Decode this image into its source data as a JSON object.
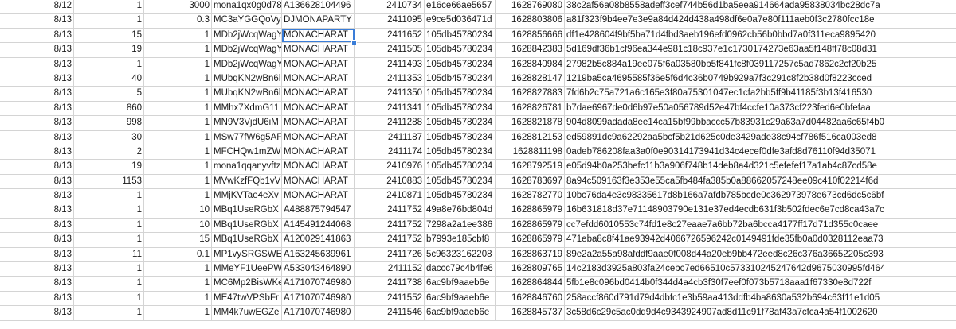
{
  "spreadsheet": {
    "selected_cell": {
      "row": 2,
      "col": 4
    },
    "rows": [
      [
        "8/12",
        "1",
        "3000",
        "mona1qx0g0d78",
        "A136628104496",
        "2410734",
        "e16ce66ae5657",
        "1628769080",
        "38c2af56a08b8558adeff3cef744b56d1ba5eea914664ada95838034bc28dc7a"
      ],
      [
        "8/13",
        "1",
        "0.3",
        "MC3aYGGQoVy",
        "DJMONAPARTY",
        "2411095",
        "e9ce5d036471d",
        "1628803806",
        "a81f323f9b4ee7e3e9a84d424d438a498df6e0a7e80f111aeb0f3c2780fcc18e"
      ],
      [
        "8/13",
        "15",
        "1",
        "MDb2jWcqWagY",
        "MONACHARAT",
        "2411652",
        "105db45780234",
        "1628856666",
        "df1e428604f9bf5ba71d4fbd3aeb196efd0962cb56b0bbd7a0f311eca9895420"
      ],
      [
        "8/13",
        "19",
        "1",
        "MDb2jWcqWagY",
        "MONACHARAT",
        "2411505",
        "105db45780234",
        "1628842383",
        "5d169df36b1cf96ea344e981c18c937e1c1730174273e63aa5f148ff78c08d31"
      ],
      [
        "8/13",
        "1",
        "1",
        "MDb2jWcqWagY",
        "MONACHARAT",
        "2411493",
        "105db45780234",
        "1628840984",
        "27982b5c884a19ee075f6a03580bb5f841fc8f039117257c5ad7862c2cf20b25"
      ],
      [
        "8/13",
        "40",
        "1",
        "MUbqKN2wBn6l",
        "MONACHARAT",
        "2411353",
        "105db45780234",
        "1628828147",
        "1219ba5ca4695585f36e5f6d4c36b0749b929a7f3c291c8f2b38d0f8223cced"
      ],
      [
        "8/13",
        "5",
        "1",
        "MUbqKN2wBn6l",
        "MONACHARAT",
        "2411350",
        "105db45780234",
        "1628827883",
        "7fd6b2c75a721a6c165e3f80a75301047ec1cfa2bb5ff9b41185f3b13f416530"
      ],
      [
        "8/13",
        "860",
        "1",
        "MMhx7XdmG11",
        "MONACHARAT",
        "2411341",
        "105db45780234",
        "1628826781",
        "b7dae6967de0d6b97e50a056789d52e47bf4ccfe10a373cf223fed6e0bfefaa"
      ],
      [
        "8/13",
        "998",
        "1",
        "MN9V3VjdU6iM",
        "MONACHARAT",
        "2411288",
        "105db45780234",
        "1628821878",
        "904d8099adada8ee14ca15bf99bbaccc57b83931c29a63a7d04482aa6c65f4b0"
      ],
      [
        "8/13",
        "30",
        "1",
        "MSw77fW6g5AF",
        "MONACHARAT",
        "2411187",
        "105db45780234",
        "1628812153",
        "ed59891dc9a62292aa5bcf5b21d625c0de3429ade38c94cf786f516ca003ed8"
      ],
      [
        "8/13",
        "2",
        "1",
        "MFCHQw1mZW",
        "MONACHARAT",
        "2411174",
        "105db45780234",
        "1628811198",
        "0adeb786208faa3a0f0e90314173941d34c4ecef0dfe3afd8d76110f94d35071"
      ],
      [
        "8/13",
        "19",
        "1",
        "mona1qqanyvftz",
        "MONACHARAT",
        "2410976",
        "105db45780234",
        "1628792519",
        "e05d94b0a253befc11b3a906f748b14deb8a4d321c5efefef17a1ab4c87cd58e"
      ],
      [
        "8/13",
        "1153",
        "1",
        "MVwKzfFQb1vV",
        "MONACHARAT",
        "2410883",
        "105db45780234",
        "1628783697",
        "8a94c509163f3e353e55ca5fb484fa385b0a88662057248ee09c410f02214f6d"
      ],
      [
        "8/13",
        "1",
        "1",
        "MMjKVTae4eXv",
        "MONACHARAT",
        "2410871",
        "105db45780234",
        "1628782770",
        "10bc76da4e3c98335617d8b166a7afdb785bcde0c362973978e673cd6dc5c6bf"
      ],
      [
        "8/13",
        "1",
        "10",
        "MBq1UseRGbX",
        "A488875794547",
        "2411752",
        "49a8e76bd804d",
        "1628865979",
        "16b631818d37e71148903790e131e37ed4ecdb631f3b502fdec6e7cd8ca43a7c"
      ],
      [
        "8/13",
        "1",
        "10",
        "MBq1UseRGbX",
        "A145491244068",
        "2411752",
        "7298a2a1ee386",
        "1628865979",
        "cc7efdd6010553c74fd1e8c27eaae7a6bb72ba6bcca4177ff17d71d355c0caee"
      ],
      [
        "8/13",
        "1",
        "15",
        "MBq1UseRGbX",
        "A120029141863",
        "2411752",
        "b7993e185cbf8",
        "1628865979",
        "471eba8c8f41ae93942d4066726596242c0149491fde35fb0a0d0328112eaa73"
      ],
      [
        "8/13",
        "11",
        "0.1",
        "MP1vySRGSWE",
        "A163245639961",
        "2411726",
        "5c96323162208",
        "1628863719",
        "89e2a2a55a98afddf9aae0f008d44a20eb9bb472eed8c26c376a36652205c393"
      ],
      [
        "8/13",
        "1",
        "1",
        "MMeYF1UeePW",
        "A533043464890",
        "2411152",
        "daccc79c4b4fe6",
        "1628809765",
        "14c2183d3925a803fa24cebc7ed66510c573310245247642d9675030995fd464"
      ],
      [
        "8/13",
        "1",
        "1",
        "MC6Mp2BisWKe",
        "A171070746980",
        "2411738",
        "6ac9bf9aaeb6e",
        "1628864844",
        "5fb1e8c096bd0414b0f344d4a4cb3f30f7eef0f073b5718aaa1f67330e8d722f"
      ],
      [
        "8/13",
        "1",
        "1",
        "ME47twVPSbFr",
        "A171070746980",
        "2411552",
        "6ac9bf9aaeb6e",
        "1628846760",
        "258accf860d791d79d4dbfc1e3b59aa413ddfb4ba8630a532b694c63f11e1d05"
      ],
      [
        "8/13",
        "1",
        "1",
        "MM4k7uwEGZe",
        "A171070746980",
        "2411546",
        "6ac9bf9aaeb6e",
        "1628845737",
        "3c58d6c29c5ac0dd9d4c9343924907ad8d11c91f78af43a7cfca4a54f1002620"
      ]
    ]
  }
}
